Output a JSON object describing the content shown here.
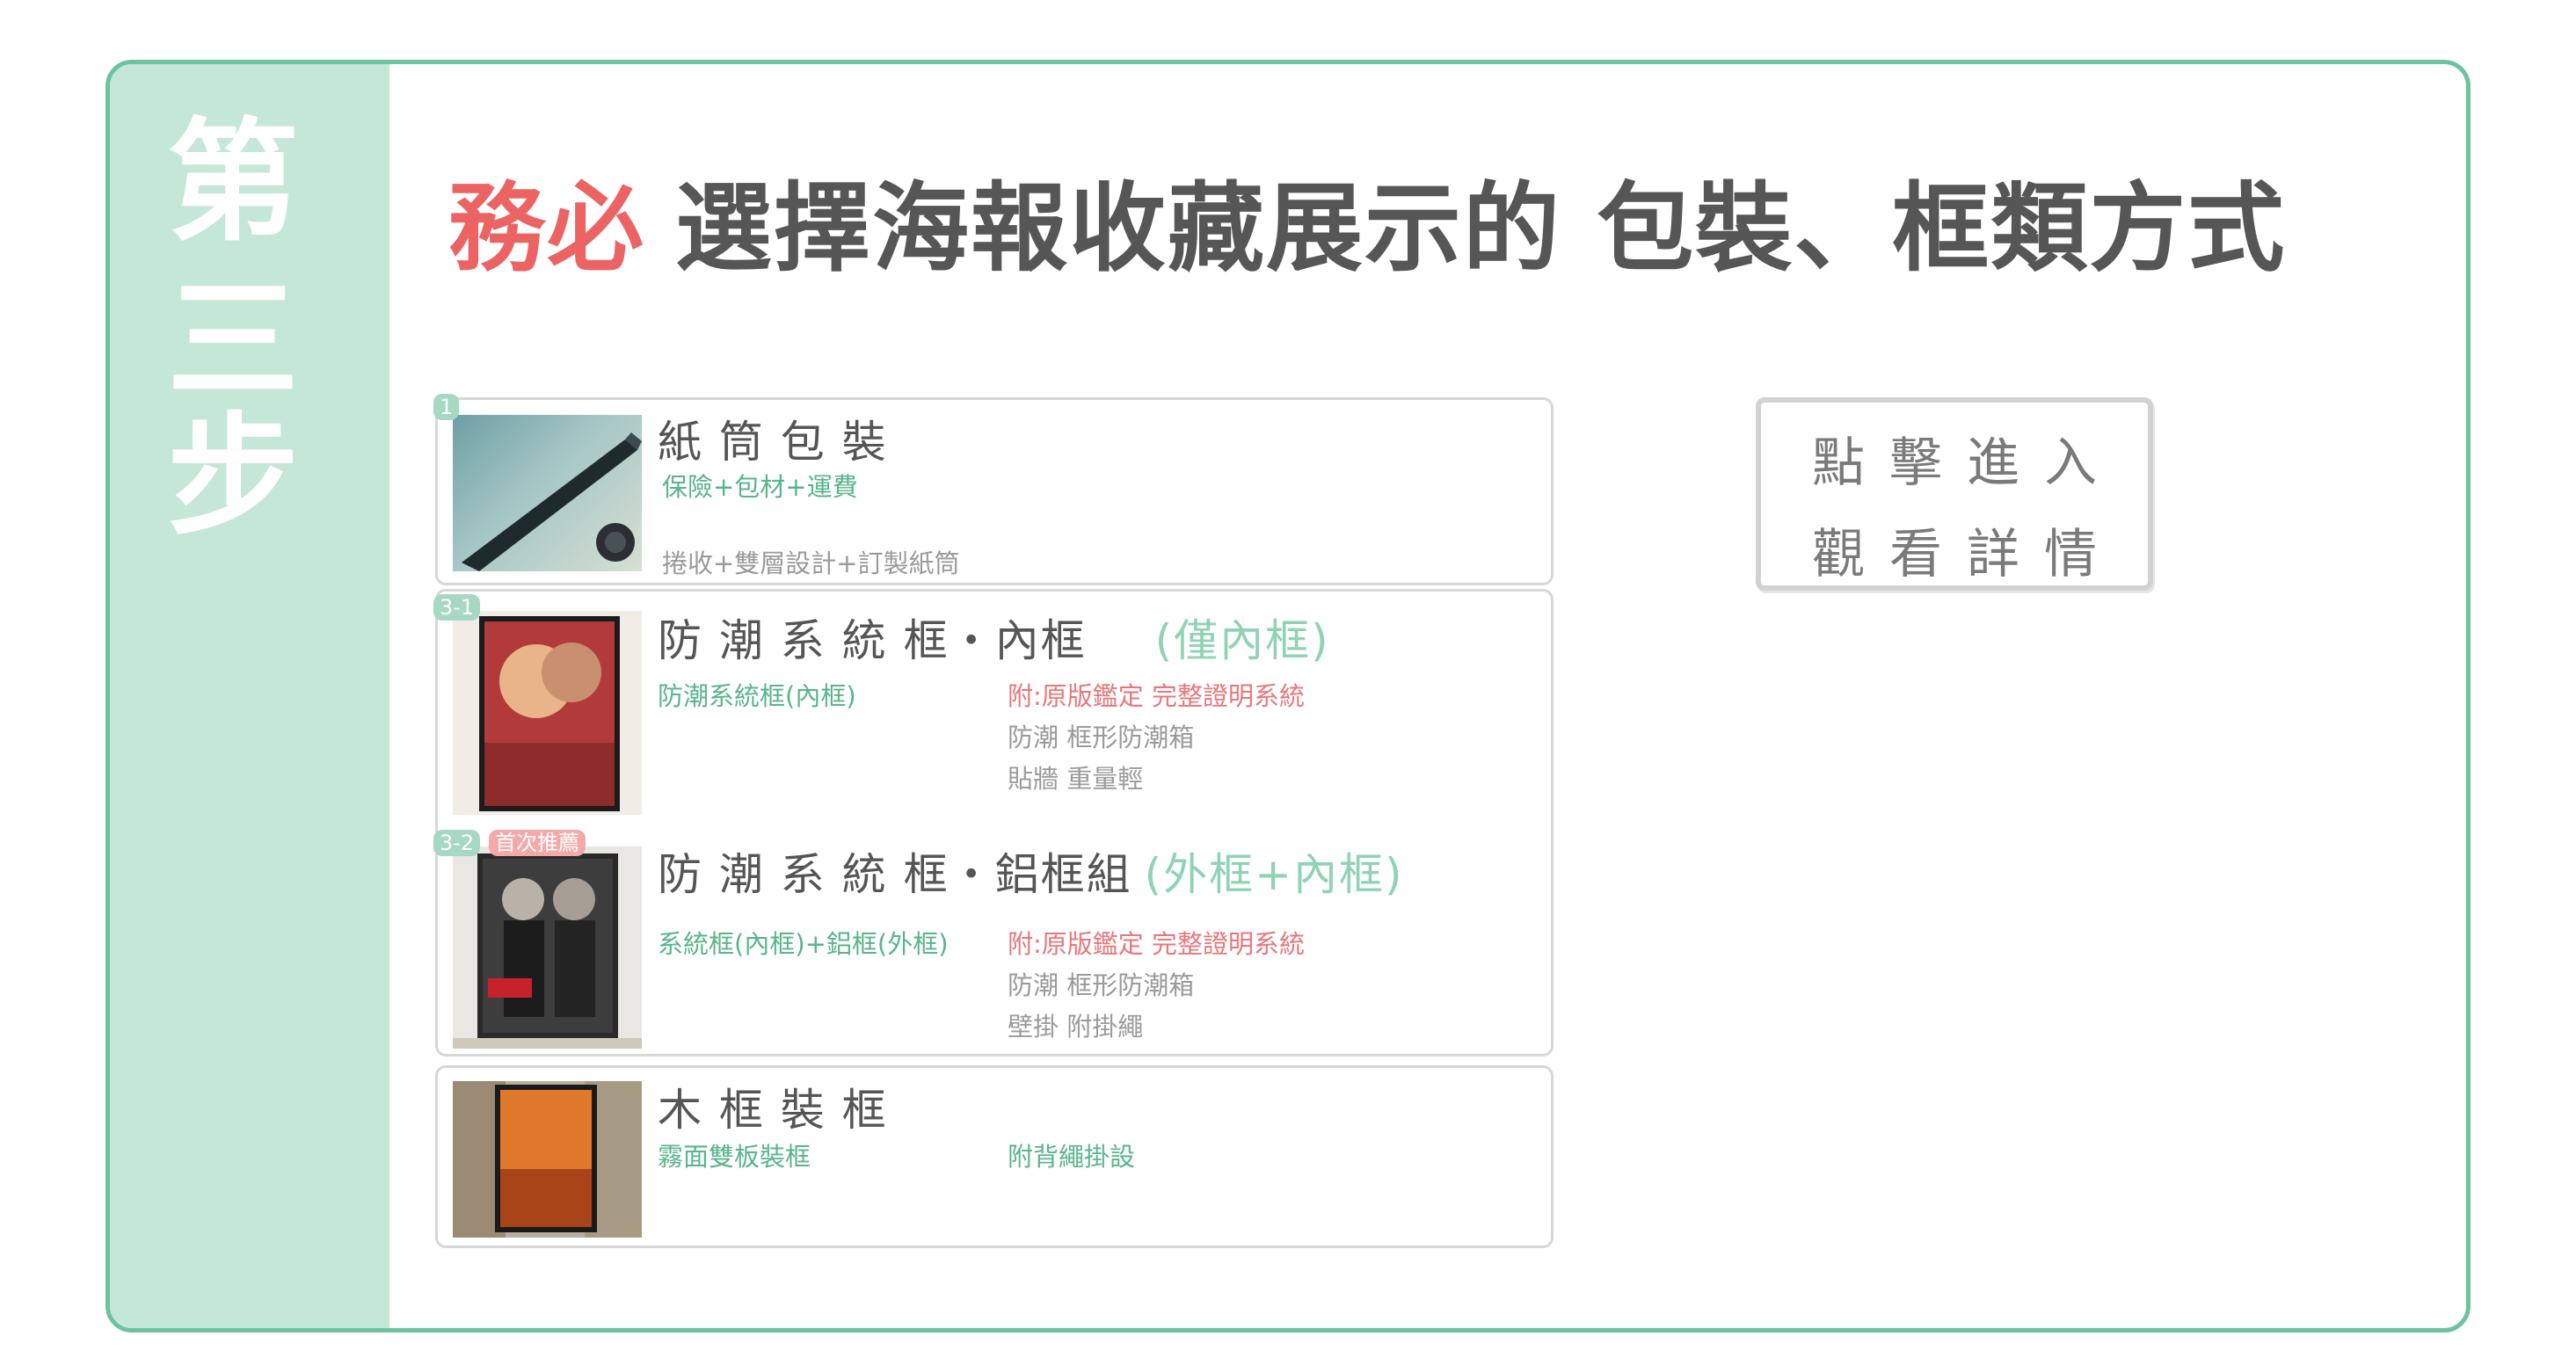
{
  "sidebar": {
    "chars": [
      "第",
      "三",
      "步"
    ]
  },
  "headline": {
    "highlight": "務必",
    "text": "選擇海報收藏展示的 包裝、框類方式"
  },
  "cards": [
    {
      "badge": "1",
      "title": "紙 筒 包 裝",
      "lines": {
        "a": "保險+包材+運費",
        "b": "捲收+雙層設計+訂製紙筒"
      }
    },
    {
      "badge": "3-1",
      "title": "防 潮 系 統 框・內框",
      "title_sub": "(僅內框)",
      "left": "防潮系統框(內框)",
      "right": [
        "附:原版鑑定 完整證明系統",
        "防潮 框形防潮箱",
        "貼牆 重量輕"
      ]
    },
    {
      "badge": "3-2",
      "recommend": "首次推薦",
      "title": "防 潮 系 統 框・鋁框組",
      "title_sub": "(外框+內框)",
      "left": "系統框(內框)+鋁框(外框)",
      "right": [
        "附:原版鑑定 完整證明系統",
        "防潮 框形防潮箱",
        "壁掛 附掛繩"
      ]
    },
    {
      "title": "木 框 裝 框",
      "left": "霧面雙板裝框",
      "right": "附背繩掛設"
    }
  ],
  "cta": {
    "line1": "點擊進入",
    "line2": "觀看詳情"
  }
}
